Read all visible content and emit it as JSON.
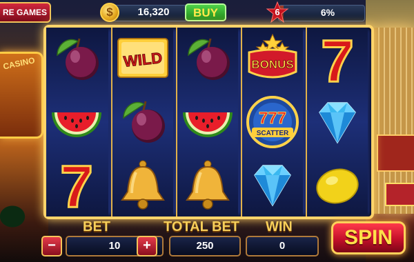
{
  "hud": {
    "more_games_label": "RE GAMES",
    "coins": "16,320",
    "coin_symbol": "$",
    "buy_label": "BUY",
    "level": "6",
    "level_progress": "6%",
    "level_progress_fraction": 0.06
  },
  "reels": [
    [
      "plum",
      "watermelon",
      "seven"
    ],
    [
      "wild",
      "plum",
      "bell"
    ],
    [
      "plum",
      "watermelon",
      "bell"
    ],
    [
      "bonus",
      "scatter",
      "diamond"
    ],
    [
      "seven",
      "diamond",
      "lemon"
    ]
  ],
  "symbol_text": {
    "wild": "WILD",
    "bonus": "BONUS",
    "scatter_top": "777",
    "scatter_label": "SCATTER",
    "seven": "7"
  },
  "controls": {
    "bet_label": "BET",
    "bet_value": "10",
    "minus_label": "−",
    "plus_label": "+",
    "total_bet_label": "TOTAL BET",
    "total_bet_value": "250",
    "win_label": "WIN",
    "win_value": "0",
    "spin_label": "SPIN"
  },
  "colors": {
    "accent_gold": "#ffd46a",
    "buy_green": "#1f8a1a",
    "spin_red": "#c4102a",
    "reel_blue": "#1d2f78"
  }
}
